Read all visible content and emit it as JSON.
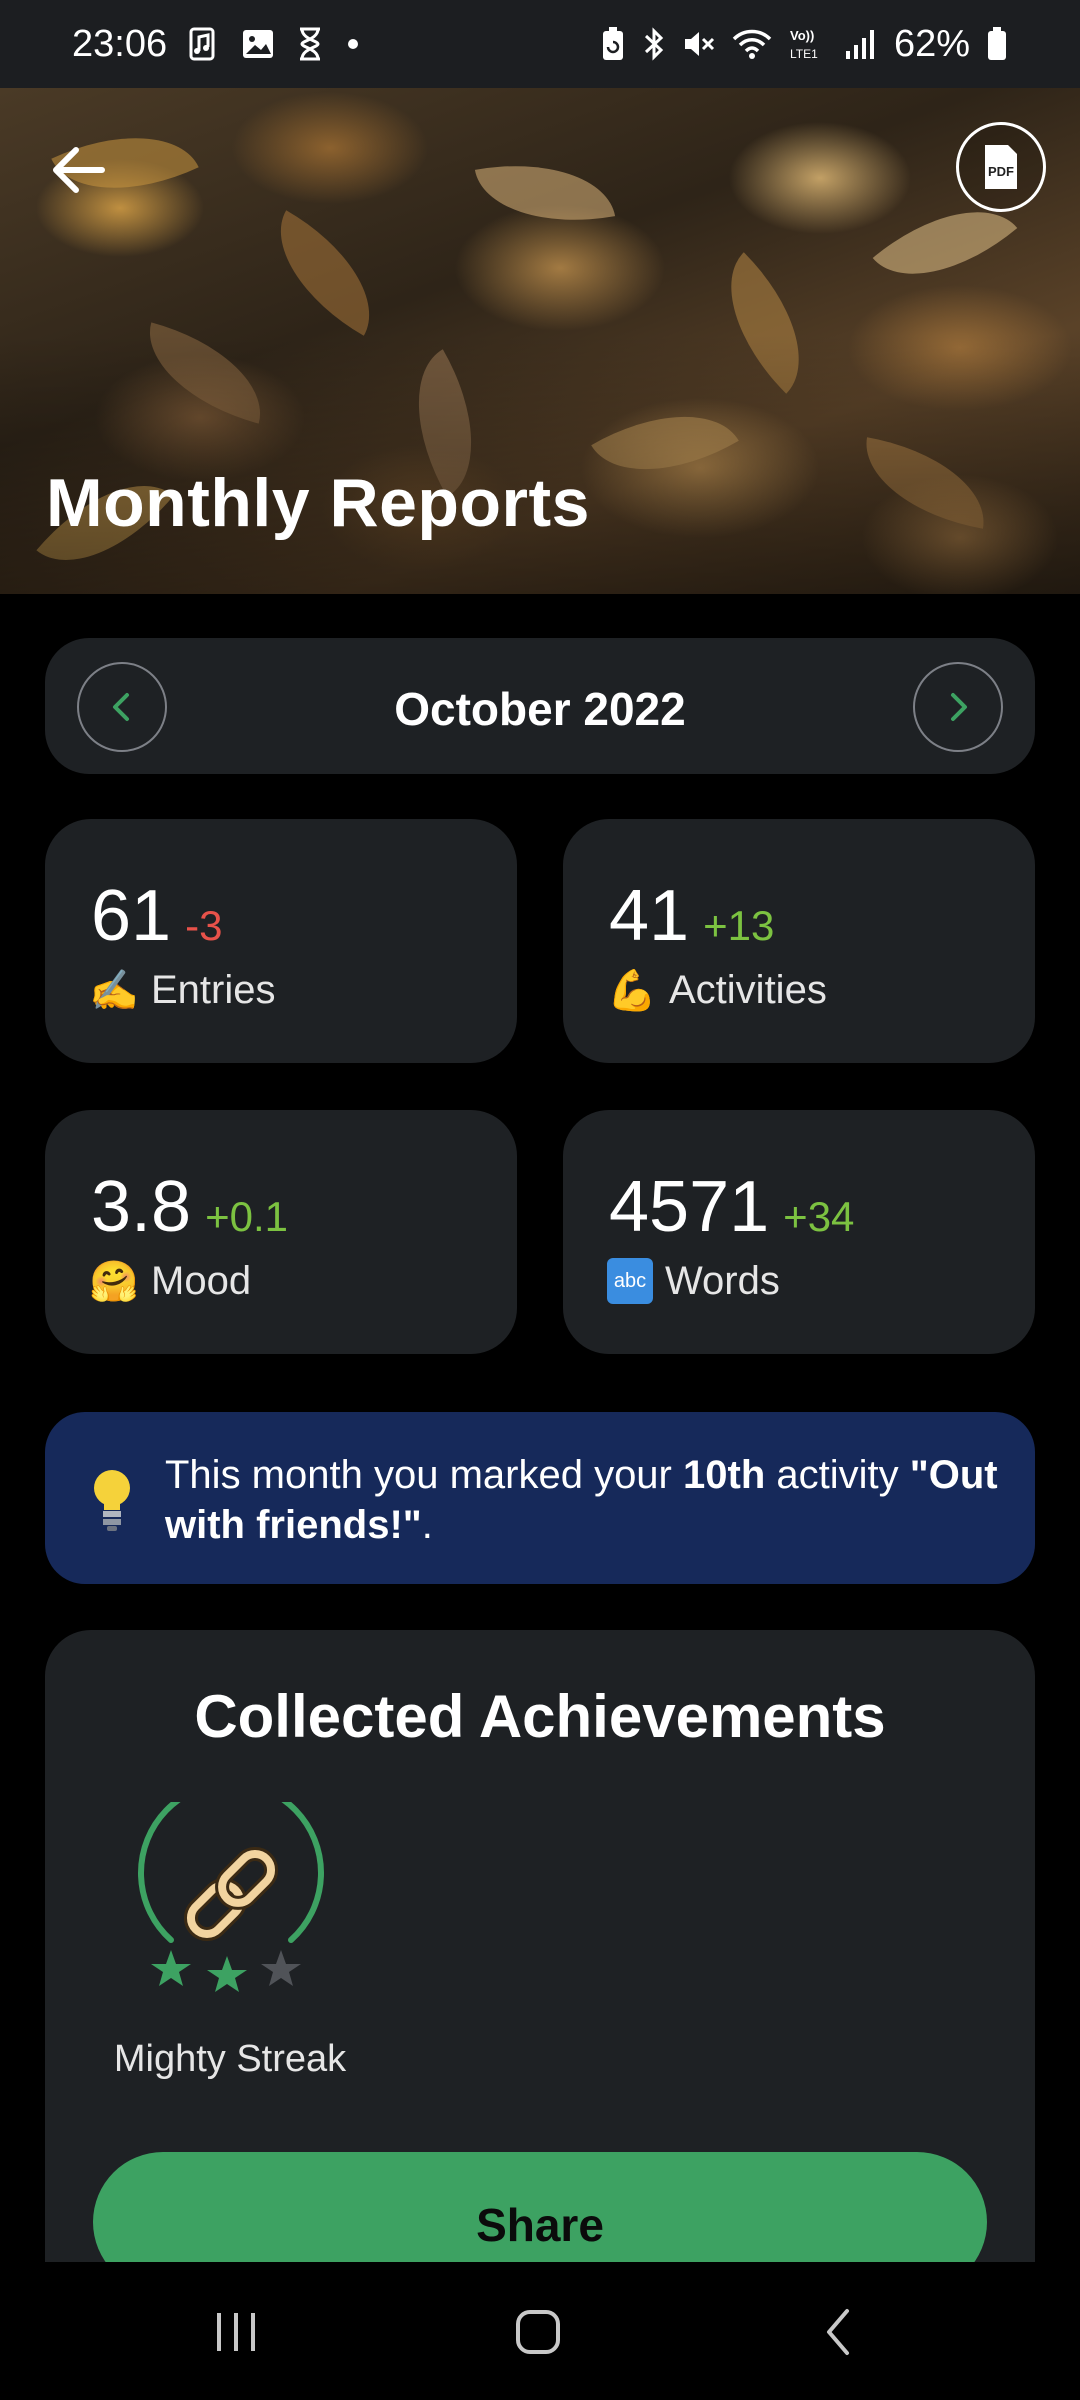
{
  "status_bar": {
    "time": "23:06",
    "battery": "62%",
    "icons_left": [
      "music-note-icon",
      "image-icon",
      "hourglass-icon",
      "dot-icon"
    ],
    "icons_right": [
      "battery-saver-icon",
      "bluetooth-icon",
      "mute-icon",
      "wifi-icon",
      "volte-icon",
      "signal-icon",
      "battery-icon"
    ]
  },
  "header": {
    "title": "Monthly Reports",
    "back_icon": "arrow-left-icon",
    "pdf_icon": "pdf-document-icon",
    "pdf_label": "PDF"
  },
  "month_switcher": {
    "label": "October 2022",
    "prev_icon": "chevron-left-icon",
    "next_icon": "chevron-right-icon",
    "accent": "#3da262"
  },
  "stats": {
    "entries": {
      "value": "61",
      "delta": "-3",
      "emoji": "✍️",
      "label": "Entries"
    },
    "activities": {
      "value": "41",
      "delta": "+13",
      "emoji": "💪",
      "label": "Activities"
    },
    "mood": {
      "value": "3.8",
      "delta": "+0.1",
      "emoji": "🤗",
      "label": "Mood"
    },
    "words": {
      "value": "4571",
      "delta": "+34",
      "emoji": "abc",
      "label": "Words"
    }
  },
  "insight": {
    "icon": "lightbulb-icon",
    "text_before": "This month you marked your ",
    "ordinal": "10th",
    "text_middle": " activity ",
    "activity": "\"Out with friends!\"",
    "text_after": "."
  },
  "achievements": {
    "title": "Collected Achievements",
    "items": [
      {
        "name": "Mighty Streak",
        "icon": "chain-link-icon",
        "stars_earned": 2,
        "stars_total": 3
      }
    ]
  },
  "share": {
    "label": "Share"
  },
  "nav_bar": {
    "recents_icon": "recents-icon",
    "home_icon": "home-icon",
    "back_icon": "back-chevron-icon"
  },
  "colors": {
    "background": "#000000",
    "card": "#1e2124",
    "accent_green": "#3da262",
    "delta_negative": "#e8524a",
    "delta_positive": "#7cc241",
    "insight_bg": "#16295a"
  }
}
